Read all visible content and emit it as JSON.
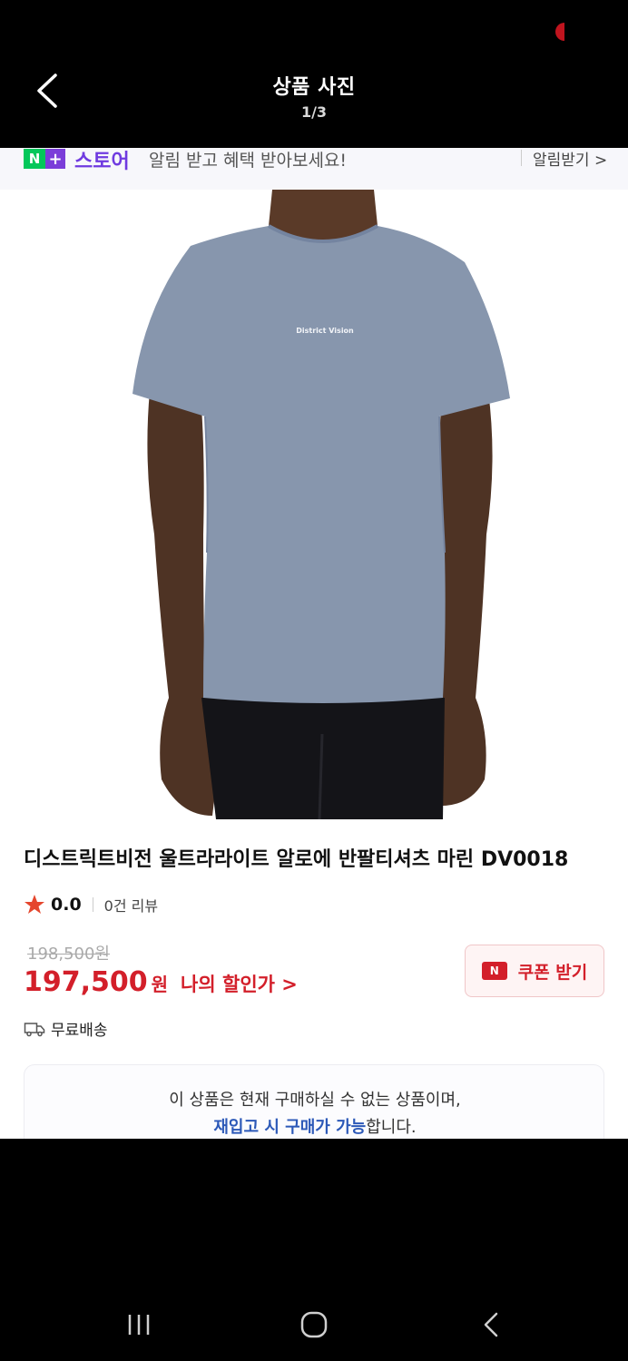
{
  "header": {
    "title": "상품 사진",
    "counter": "1/3"
  },
  "banner": {
    "logo_n": "N",
    "logo_plus": "+",
    "store_name": "스토어",
    "text": "알림 받고 혜택 받아보세요!",
    "action_label": "알림받기 >"
  },
  "product": {
    "image_icon": "product-photo-tshirt",
    "shirt_print": "District Vision",
    "title": "디스트릭트비전 울트라라이트 알로에 반팔티셔츠 마린 DV0018",
    "rating": "0.0",
    "review_count": "0건 리뷰",
    "original_price": "198,500원",
    "sale_price": "197,500",
    "sale_unit": "원",
    "discount_link": "나의 할인가 >",
    "coupon_logo": "N",
    "coupon_label": "쿠폰 받기",
    "shipping": "무료배송"
  },
  "notice": {
    "line1": "이 상품은 현재 구매하실 수 없는 상품이며,",
    "line2_highlight": "재입고 시 구매가 가능",
    "line2_rest": "합니다."
  },
  "colors": {
    "accent_red": "#d31f2a",
    "naver_green": "#03c75a",
    "store_purple": "#6f3ae0",
    "link_blue": "#2c59b8"
  }
}
